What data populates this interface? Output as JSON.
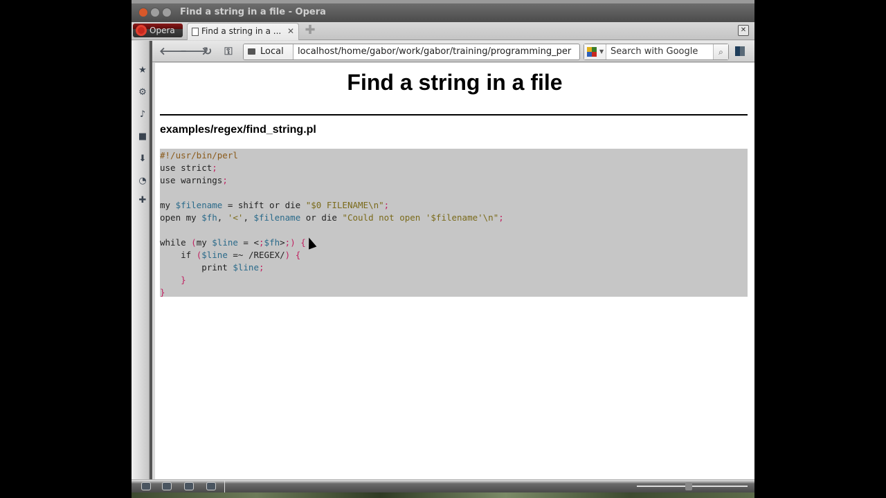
{
  "window": {
    "title": "Find a string in a file - Opera"
  },
  "tabbar": {
    "menu_label": "Opera",
    "tabs": [
      {
        "label": "Find a string in a ...",
        "active": true
      }
    ],
    "new_tab_icon": "plus-icon",
    "trash_icon": "trash-icon"
  },
  "navbar": {
    "back_icon": "arrow-left-icon",
    "forward_icon": "arrow-right-icon",
    "reload_icon": "reload-icon",
    "key_icon": "key-icon",
    "security_label": "Local",
    "url": "localhost/home/gabor/work/gabor/training/programming_per",
    "search_placeholder": "Search with Google",
    "search_engine_icon": "google-icon"
  },
  "sidepanel": {
    "items": [
      {
        "icon": "bookmark-star-icon"
      },
      {
        "icon": "widgets-gear-icon"
      },
      {
        "icon": "unite-icon"
      },
      {
        "icon": "notes-icon"
      },
      {
        "icon": "transfers-icon"
      },
      {
        "icon": "history-icon"
      },
      {
        "icon": "add-panel-icon"
      }
    ]
  },
  "page": {
    "title": "Find a string in a file",
    "filename": "examples/regex/find_string.pl",
    "code_lines": [
      "#!/usr/bin/perl",
      "use strict;",
      "use warnings;",
      "",
      "my $filename = shift or die \"$0 FILENAME\\n\";",
      "open my $fh, '<', $filename or die \"Could not open '$filename'\\n\";",
      "",
      "while (my $line = <$fh>) {",
      "    if ($line =~ /REGEX/) {",
      "        print $line;",
      "    }",
      "}"
    ]
  },
  "statusbar": {
    "icons": [
      "panel-toggle-icon",
      "unite-icon",
      "turbo-icon",
      "view-icon"
    ]
  },
  "colors": {
    "code_background": "#c6c6c6",
    "comment": "#8a5a1a",
    "variable": "#2a6a8a",
    "string": "#7a6a1a",
    "punctuation": "#c02060"
  }
}
